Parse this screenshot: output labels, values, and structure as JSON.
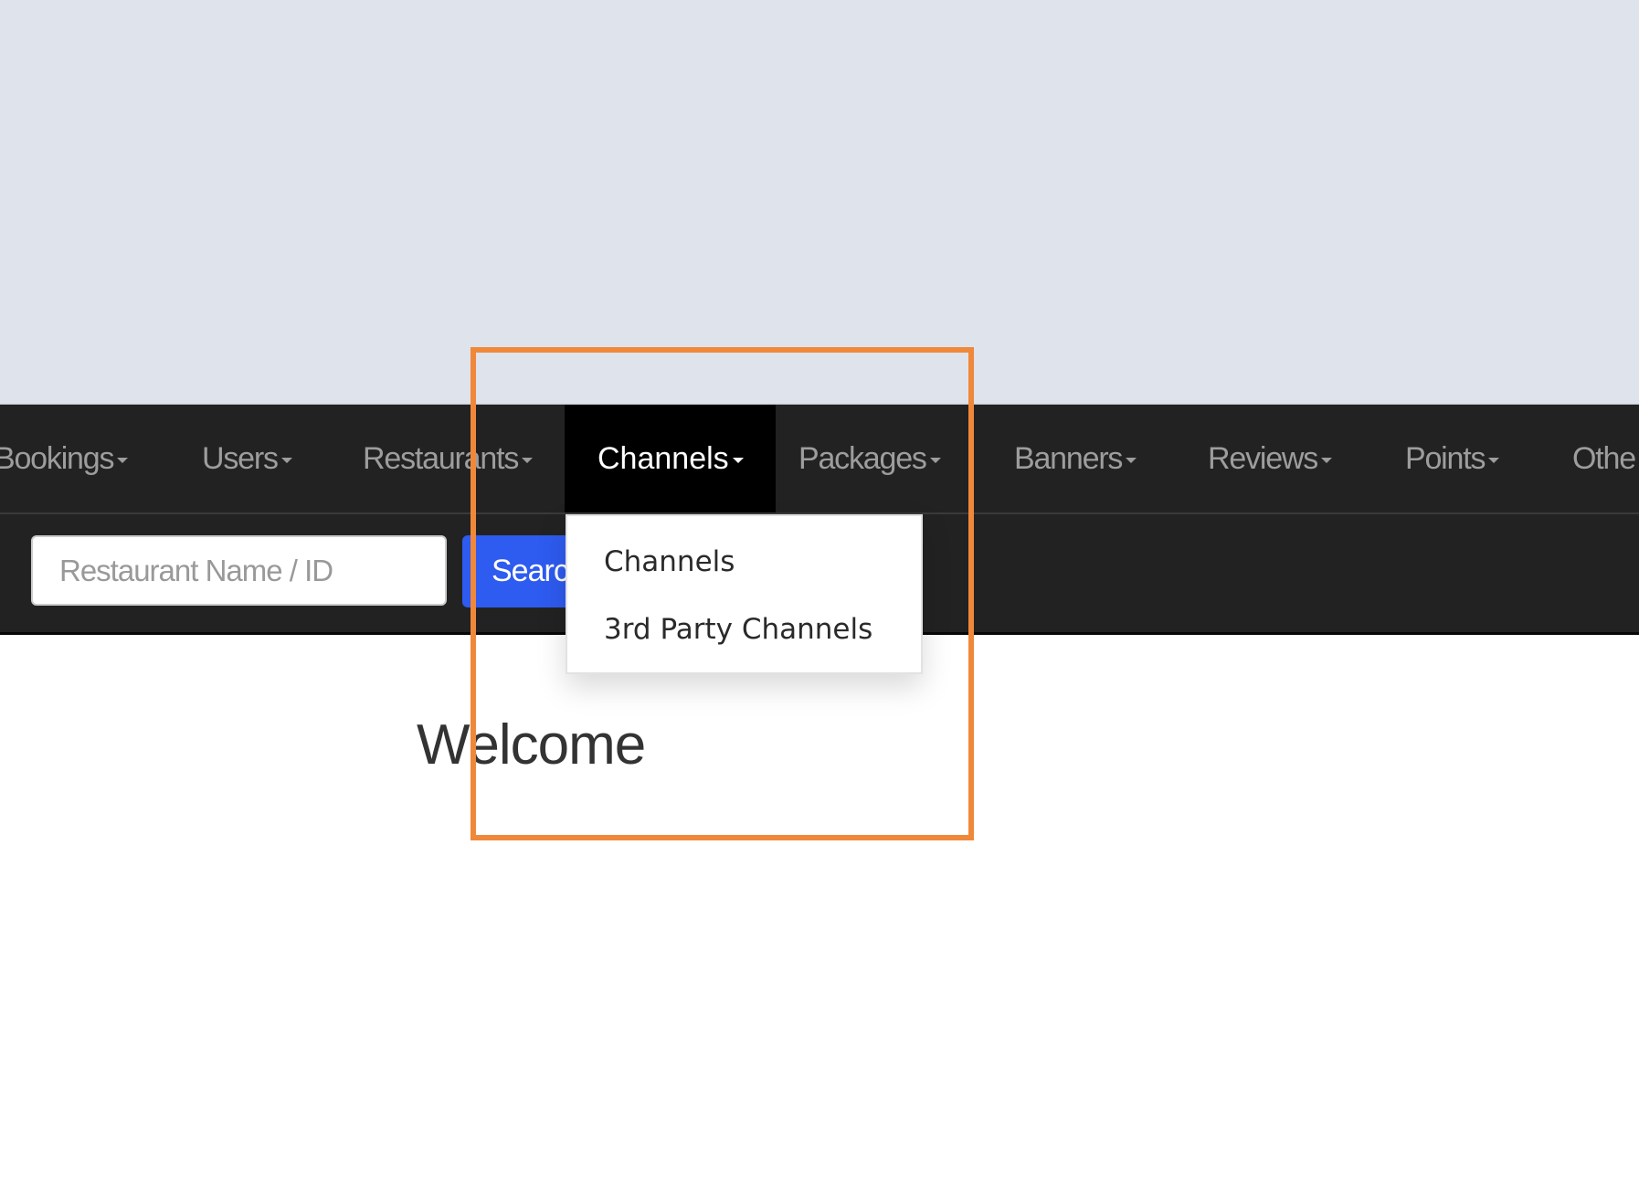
{
  "navbar": {
    "items": [
      {
        "label": "Bookings"
      },
      {
        "label": "Users"
      },
      {
        "label": "Restaurants"
      },
      {
        "label": "Channels"
      },
      {
        "label": "Packages"
      },
      {
        "label": "Banners"
      },
      {
        "label": "Reviews"
      },
      {
        "label": "Points"
      },
      {
        "label": "Othe"
      }
    ],
    "active": "Channels"
  },
  "search": {
    "placeholder": "Restaurant Name / ID",
    "button_label": "Search"
  },
  "dropdown": {
    "items": [
      {
        "label": "Channels"
      },
      {
        "label": "3rd Party Channels"
      }
    ]
  },
  "main": {
    "heading": "Welcome"
  },
  "colors": {
    "navbar": "#222222",
    "active": "#000000",
    "search_button": "#2e5bf0",
    "highlight": "#f0883a"
  }
}
